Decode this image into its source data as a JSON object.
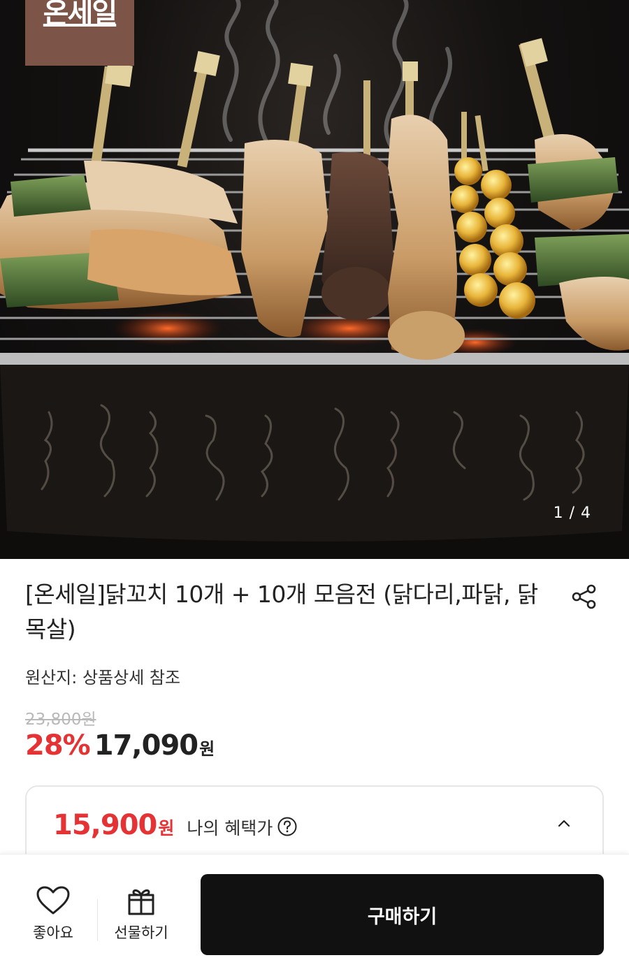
{
  "hero": {
    "brand_badge": "온세일",
    "counter": "1 / 4",
    "image_subject": "grilled chicken skewers on charcoal grill"
  },
  "product": {
    "title": "[온세일]닭꼬치 10개 + 10개 모음전 (닭다리,파닭, 닭목살)",
    "origin": "원산지: 상품상세 참조",
    "original_price": "23,800원",
    "discount_rate": "28%",
    "sale_price": "17,090",
    "currency": "원"
  },
  "benefit": {
    "price": "15,900",
    "currency": "원",
    "label": "나의 혜택가"
  },
  "bottom_bar": {
    "like_label": "좋아요",
    "gift_label": "선물하기",
    "buy_label": "구매하기"
  },
  "colors": {
    "accent_red": "#e53335",
    "brand_badge": "#7c5548",
    "buy_button": "#111111"
  },
  "icons": {
    "share": "share-icon",
    "help": "question-circle-icon",
    "collapse": "chevron-up-icon",
    "like": "heart-icon",
    "gift": "gift-icon"
  }
}
